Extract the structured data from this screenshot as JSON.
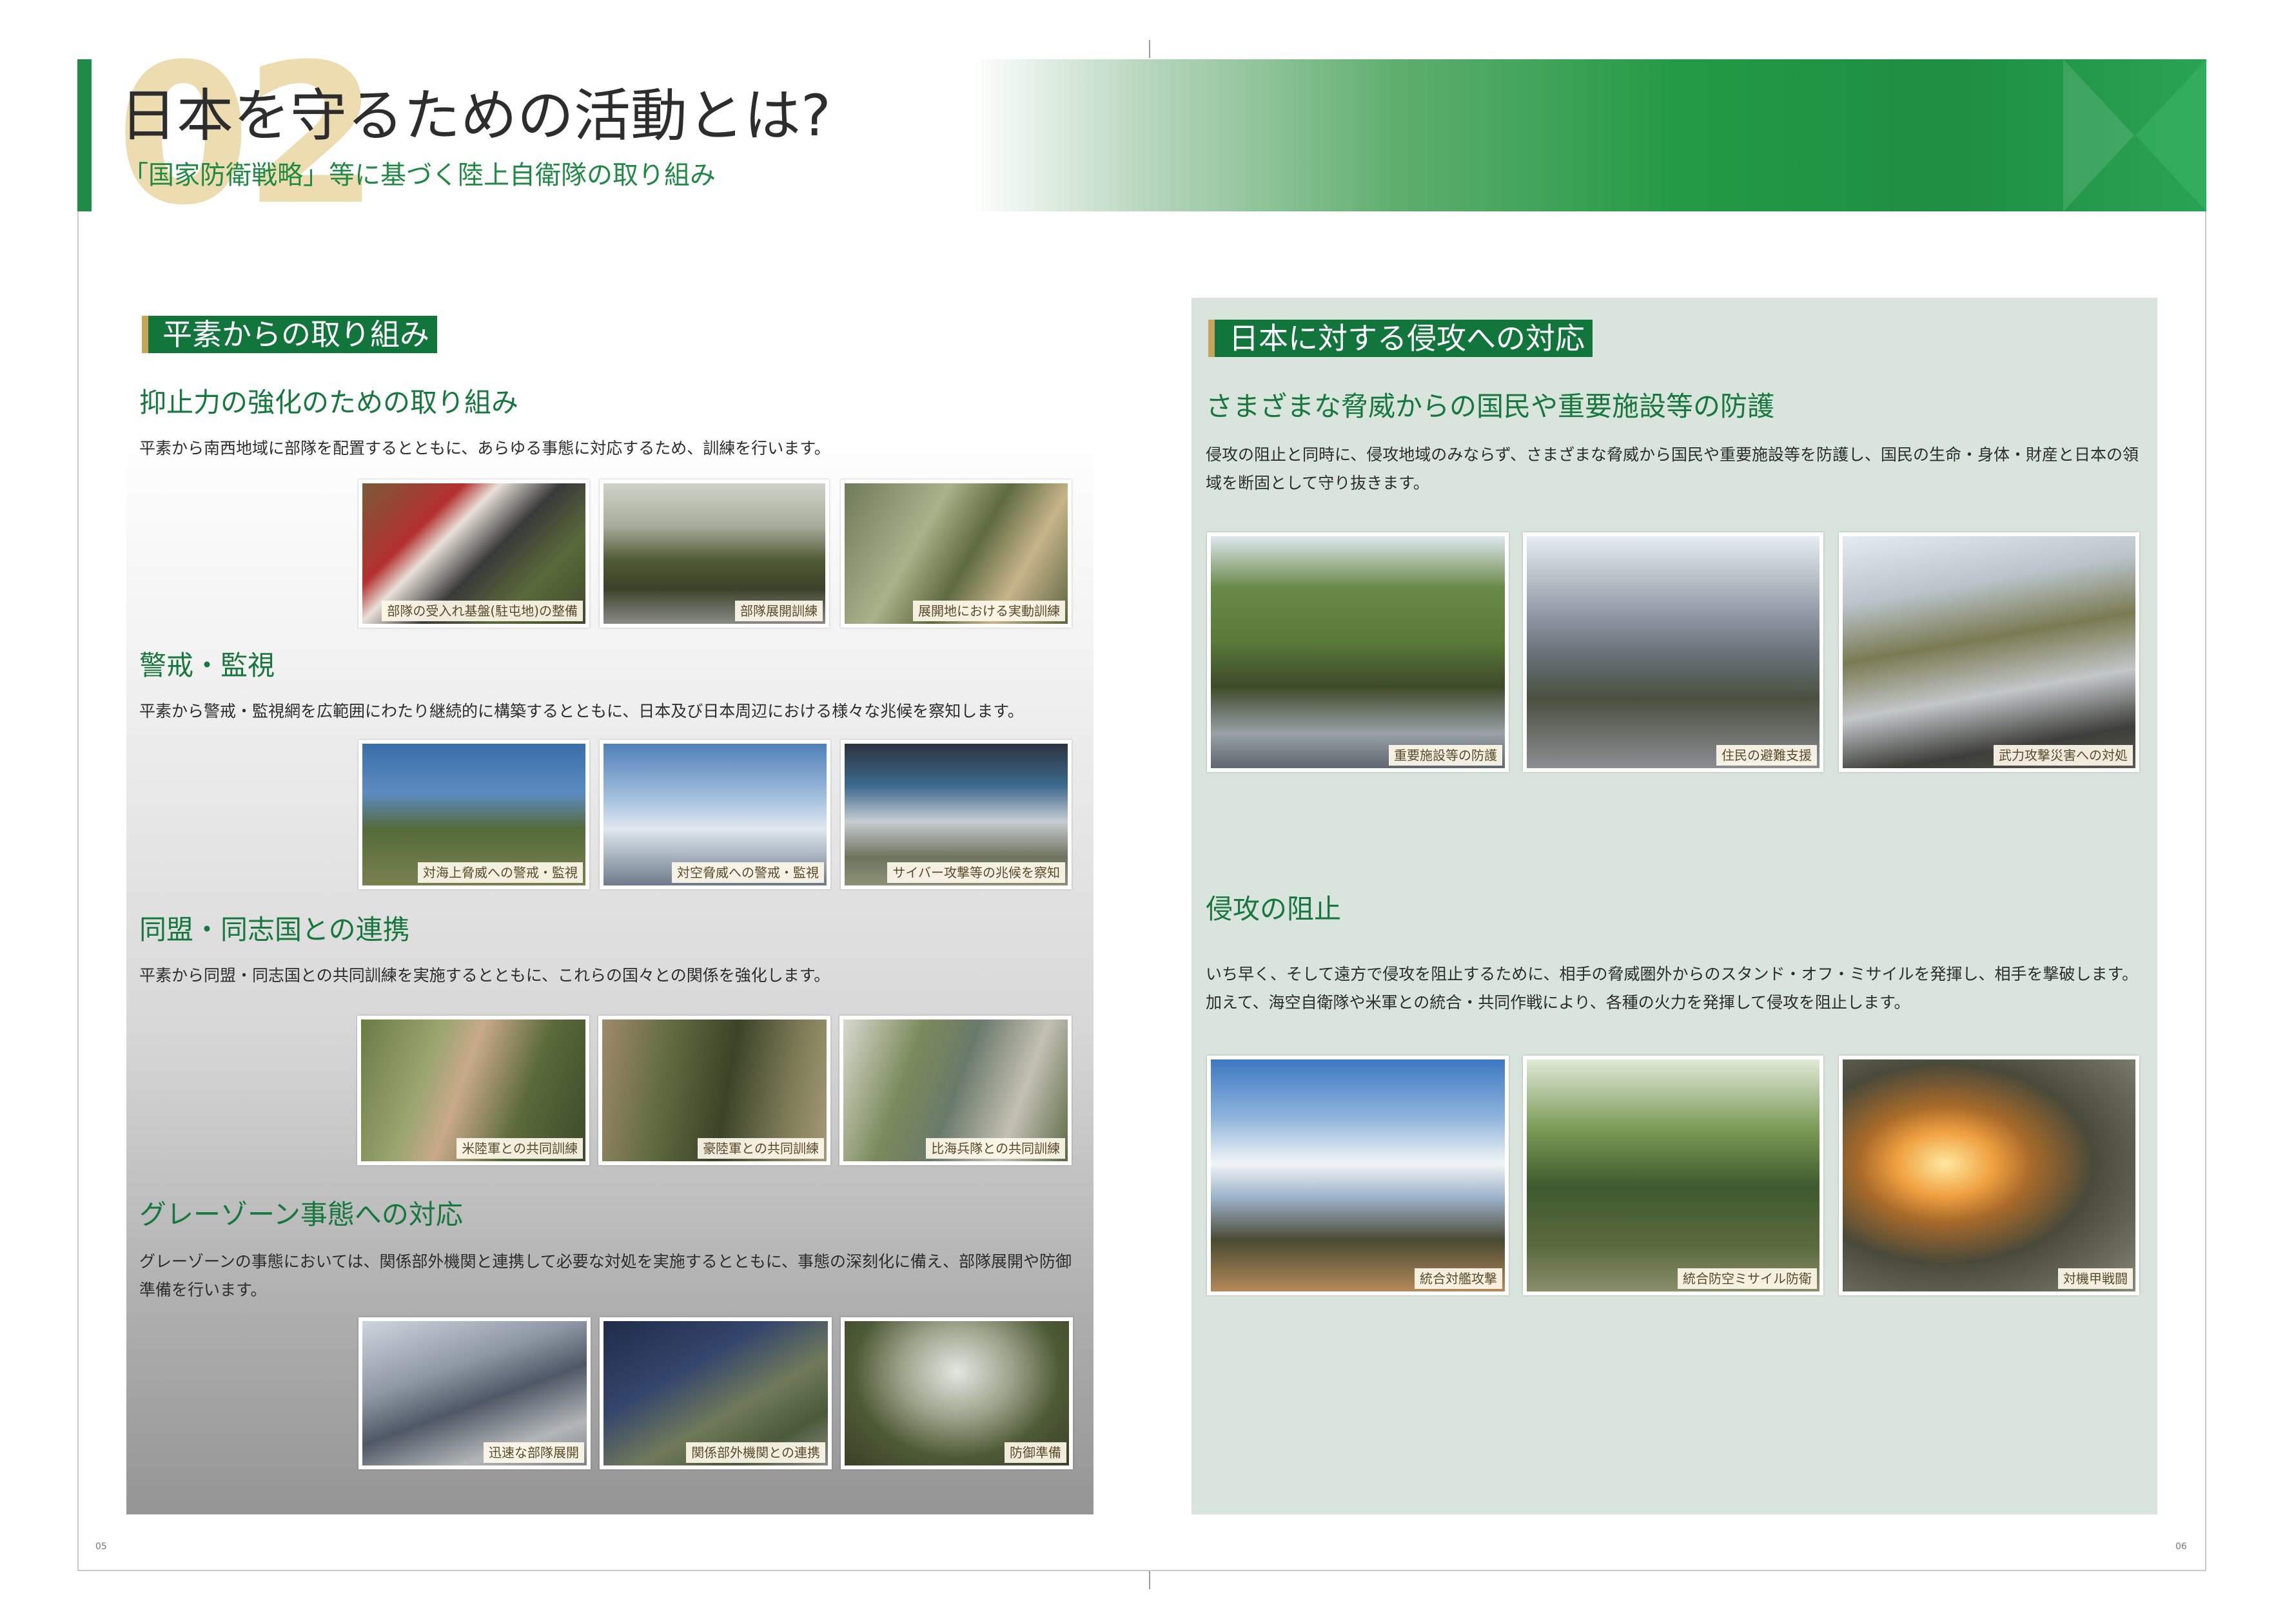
{
  "header": {
    "number": "02",
    "title": "日本を守るための活動とは?",
    "subtitle": "「国家防衛戦略」等に基づく陸上自衛隊の取り組み"
  },
  "left": {
    "section_label": "平素からの取り組み",
    "groups": [
      {
        "heading": "抑止力の強化のための取り組み",
        "text": "平素から南西地域に部隊を配置するとともに、あらゆる事態に対応するため、訓練を行います。",
        "photos": [
          "部隊の受入れ基盤(駐屯地)の整備",
          "部隊展開訓練",
          "展開地における実動訓練"
        ]
      },
      {
        "heading": "警戒・監視",
        "text": "平素から警戒・監視網を広範囲にわたり継続的に構築するとともに、日本及び日本周辺における様々な兆候を察知します。",
        "photos": [
          "対海上脅威への警戒・監視",
          "対空脅威への警戒・監視",
          "サイバー攻撃等の兆候を察知"
        ]
      },
      {
        "heading": "同盟・同志国との連携",
        "text": "平素から同盟・同志国との共同訓練を実施するとともに、これらの国々との関係を強化します。",
        "photos": [
          "米陸軍との共同訓練",
          "豪陸軍との共同訓練",
          "比海兵隊との共同訓練"
        ]
      },
      {
        "heading": "グレーゾーン事態への対応",
        "text": "グレーゾーンの事態においては、関係部外機関と連携して必要な対処を実施するとともに、事態の深刻化に備え、部隊展開や防御準備を行います。",
        "photos": [
          "迅速な部隊展開",
          "関係部外機関との連携",
          "防御準備"
        ]
      }
    ]
  },
  "right": {
    "section_label": "日本に対する侵攻への対応",
    "groups": [
      {
        "heading": "さまざまな脅威からの国民や重要施設等の防護",
        "text": "侵攻の阻止と同時に、侵攻地域のみならず、さまざまな脅威から国民や重要施設等を防護し、国民の生命・身体・財産と日本の領域を断固として守り抜きます。",
        "photos": [
          "重要施設等の防護",
          "住民の避難支援",
          "武力攻撃災害への対処"
        ]
      },
      {
        "heading": "侵攻の阻止",
        "text": "いち早く、そして遠方で侵攻を阻止するために、相手の脅威圏外からのスタンド・オフ・ミサイルを発揮し、相手を撃破します。加えて、海空自衛隊や米軍との統合・共同作戦により、各種の火力を発揮して侵攻を阻止します。",
        "photos": [
          "統合対艦攻撃",
          "統合防空ミサイル防衛",
          "対機甲戦闘"
        ]
      }
    ]
  },
  "footer": {
    "left_page": "05",
    "right_page": "06"
  }
}
